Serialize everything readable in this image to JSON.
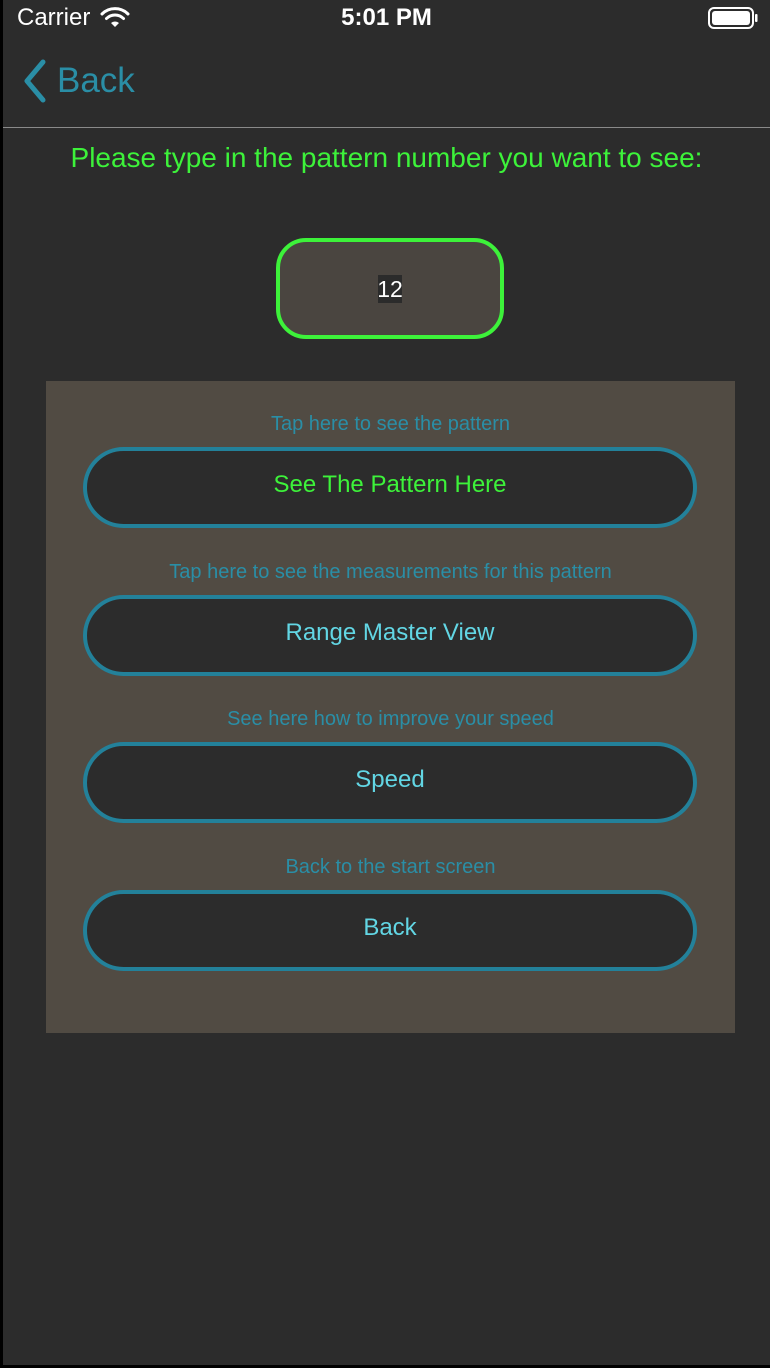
{
  "status_bar": {
    "carrier": "Carrier",
    "time": "5:01 PM"
  },
  "nav": {
    "back_label": "Back"
  },
  "prompt": {
    "text": "Please type in the pattern number you want to see:"
  },
  "pattern_input": {
    "value": "12"
  },
  "actions": [
    {
      "hint": "Tap here to see the pattern",
      "label": "See The Pattern Here"
    },
    {
      "hint": "Tap here to see the measurements for this pattern",
      "label": "Range Master View"
    },
    {
      "hint": "See here how to improve your speed",
      "label": "Speed"
    },
    {
      "hint": "Back to the start screen",
      "label": "Back"
    }
  ],
  "colors": {
    "background": "#2c2c2c",
    "panel": "#514b43",
    "accent_green": "#3df23a",
    "accent_teal": "#2a8ea6",
    "button_text": "#62d6e4"
  }
}
